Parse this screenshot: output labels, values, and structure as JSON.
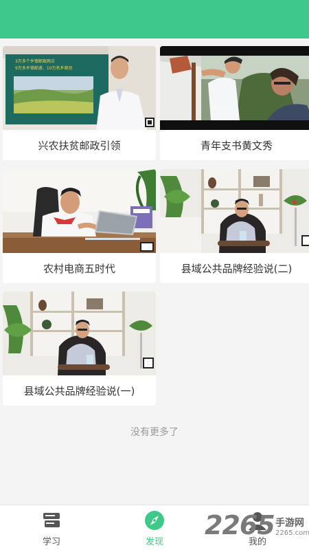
{
  "colors": {
    "accent": "#3ec98a",
    "background": "#f4f4f4",
    "card": "#ffffff"
  },
  "videos": [
    {
      "title": "兴农扶贫邮政引领",
      "screen_line1": "3万多个乡镇邮政网点",
      "screen_line2": "9万多乡镇邮递、10万名乡邮员"
    },
    {
      "title": "青年支书黄文秀"
    },
    {
      "title": "农村电商五时代"
    },
    {
      "title": "县域公共品牌经验说(二)"
    },
    {
      "title": "县域公共品牌经验说(一)"
    }
  ],
  "end_text": "没有更多了",
  "tabs": [
    {
      "label": "学习",
      "icon": "books-icon"
    },
    {
      "label": "发现",
      "icon": "compass-icon"
    },
    {
      "label": "我的",
      "icon": "user-icon"
    }
  ],
  "active_tab": "发现",
  "watermark": {
    "number": "2265",
    "text": "手游网",
    "url": "2265.com"
  }
}
